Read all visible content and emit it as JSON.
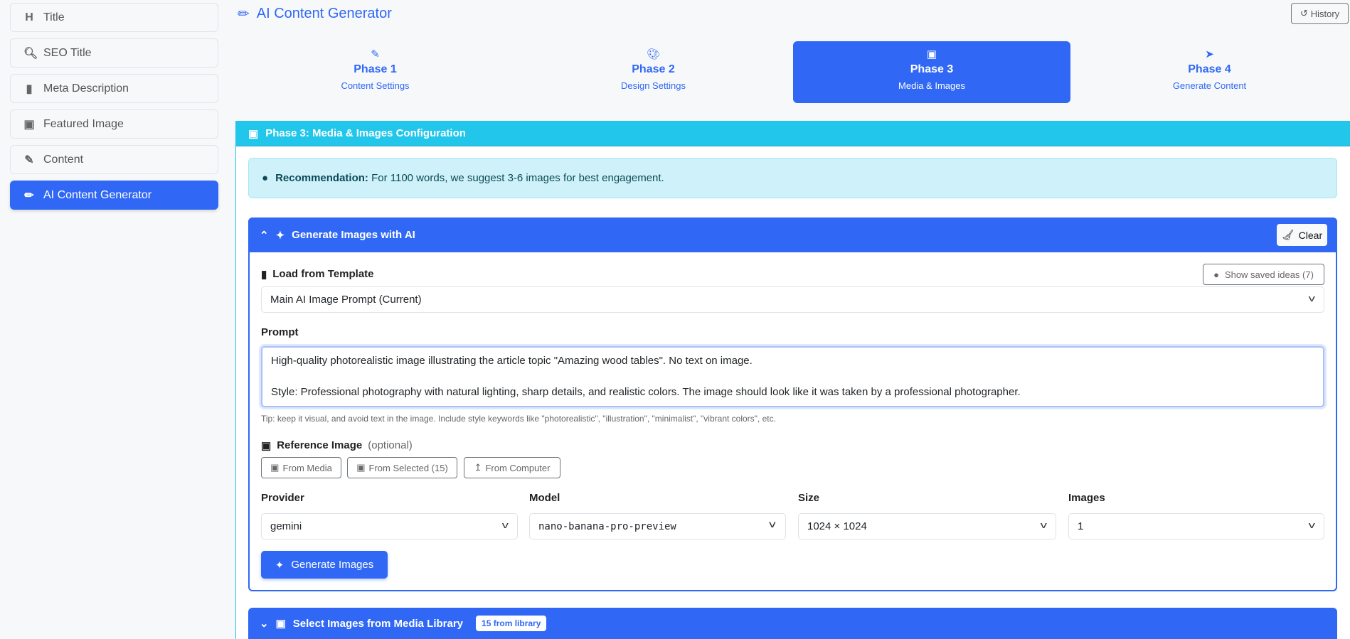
{
  "sidebar": {
    "items": [
      {
        "label": "Title",
        "icon": "heading-icon"
      },
      {
        "label": "SEO Title",
        "icon": "search-icon"
      },
      {
        "label": "Meta Description",
        "icon": "file-icon"
      },
      {
        "label": "Featured Image",
        "icon": "image-icon"
      },
      {
        "label": "Content",
        "icon": "edit-icon"
      },
      {
        "label": "AI Content Generator",
        "icon": "pencil-icon",
        "active": true
      }
    ]
  },
  "header": {
    "title": "AI Content Generator",
    "history": "History"
  },
  "tabs": [
    {
      "name": "Phase 1",
      "sub": "Content Settings"
    },
    {
      "name": "Phase 2",
      "sub": "Design Settings"
    },
    {
      "name": "Phase 3",
      "sub": "Media & Images"
    },
    {
      "name": "Phase 4",
      "sub": "Generate Content"
    }
  ],
  "card": {
    "title": "Phase 3: Media & Images Configuration"
  },
  "alert": {
    "strong": "Recommendation:",
    "text": "For 1100 words, we suggest 3-6 images for best engagement."
  },
  "panel": {
    "title": "Generate Images with AI",
    "clear": "Clear",
    "template_label": "Load from Template",
    "saved_ideas": "Show saved ideas (7)",
    "template_value": "Main AI Image Prompt (Current)",
    "prompt_label": "Prompt",
    "prompt_line1": "High-quality photorealistic image illustrating the article topic \"Amazing wood tables\". No text on image.",
    "prompt_line2": "Style: Professional photography with natural lighting, sharp details, and realistic colors. The image should look like it was taken by a professional photographer.",
    "tip": "Tip: keep it visual, and avoid text in the image. Include style keywords like \"photorealistic\", \"illustration\", \"minimalist\", \"vibrant colors\", etc.",
    "ref_label": "Reference Image",
    "ref_optional": "(optional)",
    "from_media": "From Media",
    "from_selected": "From Selected (15)",
    "from_computer": "From Computer",
    "provider_label": "Provider",
    "provider": "gemini",
    "model_label": "Model",
    "model": "nano-banana-pro-preview",
    "size_label": "Size",
    "size": "1024 × 1024",
    "images_label": "Images",
    "images": "1",
    "generate": "Generate Images"
  },
  "library": {
    "title": "Select Images from Media Library",
    "badge": "15 from library"
  }
}
